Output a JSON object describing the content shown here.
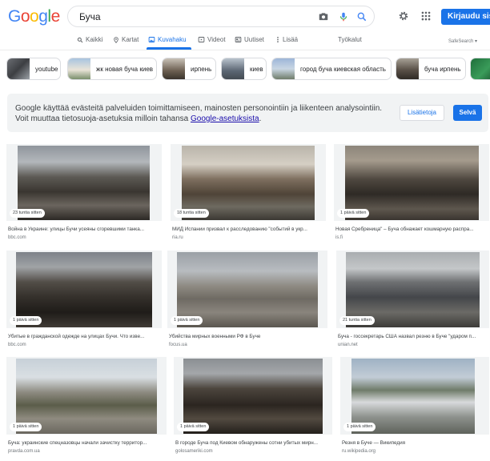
{
  "header": {
    "logo_letters": [
      {
        "ch": "G",
        "color": "#4285f4"
      },
      {
        "ch": "o",
        "color": "#ea4335"
      },
      {
        "ch": "o",
        "color": "#fbbc05"
      },
      {
        "ch": "g",
        "color": "#4285f4"
      },
      {
        "ch": "l",
        "color": "#34a853"
      },
      {
        "ch": "e",
        "color": "#ea4335"
      }
    ],
    "search_query": "Буча",
    "login_label": "Kirjaudu sisään"
  },
  "tabs": {
    "all": "Kaikki",
    "maps": "Kartat",
    "images": "Kuvahaku",
    "videos": "Videot",
    "news": "Uutiset",
    "more": "Lisää",
    "tools": "Työkalut",
    "safesearch": "SafeSearch ▾"
  },
  "chips": [
    {
      "label": "youtube"
    },
    {
      "label": "жк новая буча киев"
    },
    {
      "label": "ирпень"
    },
    {
      "label": "киев"
    },
    {
      "label": "город буча киевская область"
    },
    {
      "label": "буча ирпень"
    }
  ],
  "consent": {
    "line1": "Google käyttää evästeitä palveluiden toimittamiseen, mainosten personointiin ja liikenteen analysointiin.",
    "line2_prefix": "Voit muuttaa tietosuoja-asetuksia milloin tahansa ",
    "line2_link": "Google-asetuksista",
    "line2_suffix": ".",
    "info_button": "Lisätietoja",
    "ok_button": "Selvä"
  },
  "results": [
    {
      "badge": "23 tuntia sitten",
      "title": "Война в Украине: улицы Бучи усеяны сгоревшими танка...",
      "source": "bbc.com"
    },
    {
      "badge": "18 tuntia sitten",
      "title": "МИД Испании призвал к расследованию \"событий в укр...",
      "source": "ria.ru"
    },
    {
      "badge": "1 päivä sitten",
      "title": "Новая Сребреница\" – Буча обнажает кошмарную распра...",
      "source": "is.fi"
    },
    {
      "badge": "1 päivä sitten",
      "title": "Убитые в гражданской одежде на улицах Бучи. Что изве...",
      "source": "bbc.com"
    },
    {
      "badge": "1 päivä sitten",
      "title": "Убийства мирных военными РФ в Буче",
      "source": "focus.ua"
    },
    {
      "badge": "21 tuntia sitten",
      "title": "Буча - госсекретарь США назвал резню в Буче \"ударом п...",
      "source": "unian.net"
    },
    {
      "badge": "1 päivä sitten",
      "title": "Буча: украинские спецназовцы начали зачистку территор...",
      "source": "pravda.com.ua"
    },
    {
      "badge": "1 päivä sitten",
      "title": "В городе Буча под Киевом обнаружены сотни убитых мирн...",
      "source": "golosameriki.com"
    },
    {
      "badge": "1 päivä sitten",
      "title": "Резня в Буче — Википедия",
      "source": "ru.wikipedia.org"
    }
  ],
  "colors": {
    "accent": "#1a73e8",
    "link": "#1a0dab",
    "consent_bg": "#f1f3f4"
  }
}
